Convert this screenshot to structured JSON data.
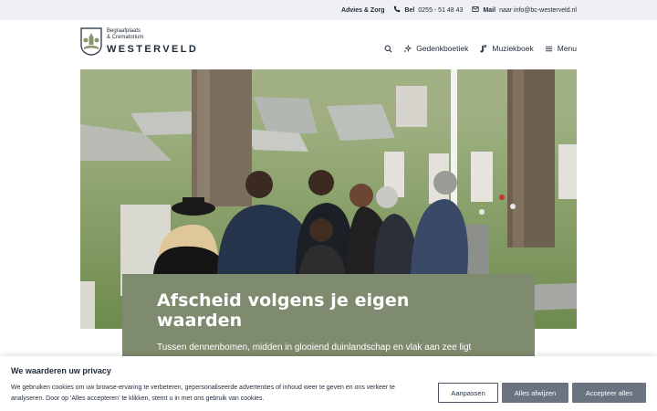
{
  "topbar": {
    "advice_label": "Advies & Zorg",
    "call_label": "Bel",
    "call_number": "0255 - 51 48 43",
    "mail_label": "Mail",
    "mail_text": "naar info@bc-westerveld.nl"
  },
  "logo": {
    "line1": "Begraafplaats",
    "line2": "& Crematorium",
    "name": "WESTERVELD"
  },
  "nav": {
    "items": [
      {
        "label": "Gedenkboetiek",
        "icon": "sparkles-icon"
      },
      {
        "label": "Muziekboek",
        "icon": "music-note-icon"
      },
      {
        "label": "Menu",
        "icon": "hamburger-icon"
      }
    ],
    "search_icon": "search-icon"
  },
  "hero": {
    "title": "Afscheid volgens je eigen waarden",
    "subtitle": "Tussen dennenbomen, midden in glooiend duinlandschap en vlak aan zee ligt Begraafplaats & Crematorium Westerveld."
  },
  "cookie": {
    "title": "We waarderen uw privacy",
    "text": "We gebruiken cookies om uw browse-ervaring te verbeteren, gepersonaliseerde advertenties of inhoud weer te geven en ons verkeer te analyseren. Door op 'Alles accepteren' te klikken, stemt u in met ons gebruik van cookies.",
    "buttons": {
      "customize": "Aanpassen",
      "reject": "Alles afwijzen",
      "accept": "Accepteer alles"
    }
  },
  "colors": {
    "topbar_bg": "#eef0f3",
    "card_bg": "#7f8b6e",
    "button_gray": "#6b7280",
    "text_dark": "#1f2a38"
  }
}
